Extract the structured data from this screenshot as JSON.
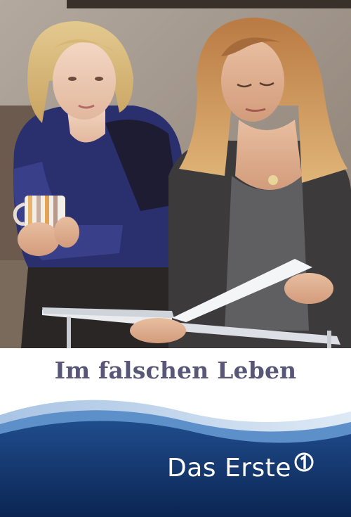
{
  "poster": {
    "title": "Im falschen Leben",
    "broadcaster": "Das Erste"
  },
  "colors": {
    "title_text": "#5a5678",
    "footer_navy": "#0d2c5e",
    "footer_wave": "#2a5e9e"
  },
  "icons": {
    "broadcaster_logo": "ard-one-logo-icon"
  }
}
